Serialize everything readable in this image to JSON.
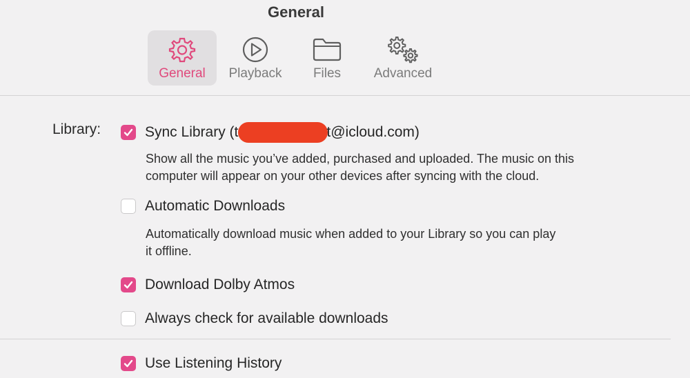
{
  "window": {
    "title": "General"
  },
  "tabs": [
    {
      "label": "General",
      "icon": "gear-icon",
      "active": true
    },
    {
      "label": "Playback",
      "icon": "play-circle-icon",
      "active": false
    },
    {
      "label": "Files",
      "icon": "folder-icon",
      "active": false
    },
    {
      "label": "Advanced",
      "icon": "gears-icon",
      "active": false
    }
  ],
  "colors": {
    "accent": "#e3498a",
    "redaction": "#ec3f22"
  },
  "library": {
    "label": "Library:",
    "sync": {
      "checked": true,
      "prefix": "Sync Library (",
      "email_start": "t",
      "email_end": "t@icloud.com)",
      "description_line1": "Show all the music you’ve added, purchased and uploaded. The music on this",
      "description_line2": "computer will appear on your other devices after syncing with the cloud."
    },
    "auto_downloads": {
      "checked": false,
      "label": "Automatic Downloads",
      "description_line1": "Automatically download music when added to your Library so you can play",
      "description_line2": "it offline."
    },
    "dolby_atmos": {
      "checked": true,
      "label": "Download Dolby Atmos"
    },
    "check_downloads": {
      "checked": false,
      "label": "Always check for available downloads"
    }
  },
  "listening_history": {
    "checked": true,
    "label": "Use Listening History"
  }
}
